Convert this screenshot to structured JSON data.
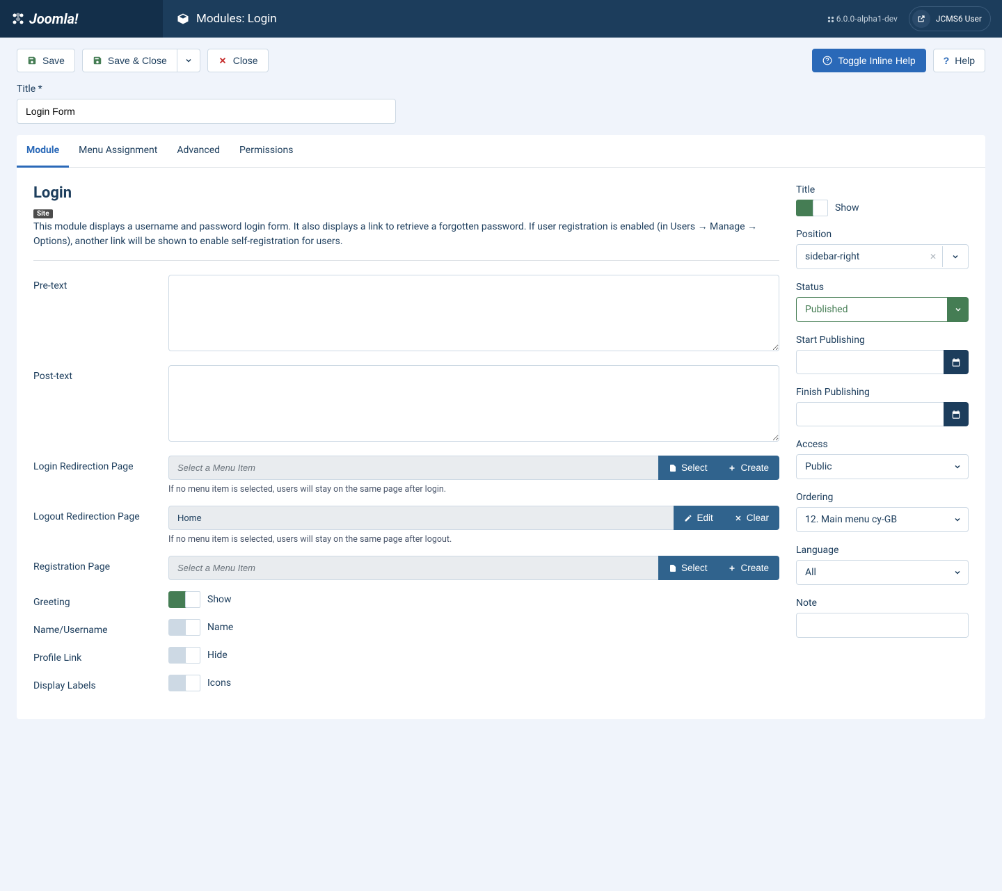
{
  "brand": "Joomla!",
  "header": {
    "title": "Modules: Login",
    "version": "6.0.0-alpha1-dev",
    "user": "JCMS6 User"
  },
  "toolbar": {
    "save": "Save",
    "save_close": "Save & Close",
    "close": "Close",
    "toggle_help": "Toggle Inline Help",
    "help": "Help"
  },
  "title_field": {
    "label": "Title *",
    "value": "Login Form"
  },
  "tabs": [
    "Module",
    "Menu Assignment",
    "Advanced",
    "Permissions"
  ],
  "module": {
    "heading": "Login",
    "badge": "Site",
    "desc": "This module displays a username and password login form. It also displays a link to retrieve a forgotten password. If user registration is enabled (in Users → Manage → Options), another link will be shown to enable self-registration for users.",
    "pretext_label": "Pre-text",
    "posttext_label": "Post-text",
    "login_redir_label": "Login Redirection Page",
    "login_redir_placeholder": "Select a Menu Item",
    "login_redir_help": "If no menu item is selected, users will stay on the same page after login.",
    "logout_redir_label": "Logout Redirection Page",
    "logout_redir_value": "Home",
    "logout_redir_help": "If no menu item is selected, users will stay on the same page after logout.",
    "reg_label": "Registration Page",
    "reg_placeholder": "Select a Menu Item",
    "select_btn": "Select",
    "create_btn": "Create",
    "edit_btn": "Edit",
    "clear_btn": "Clear",
    "greeting_label": "Greeting",
    "greeting_val": "Show",
    "nameuser_label": "Name/Username",
    "nameuser_val": "Name",
    "profile_label": "Profile Link",
    "profile_val": "Hide",
    "display_labels_label": "Display Labels",
    "display_labels_val": "Icons"
  },
  "side": {
    "title_label": "Title",
    "title_val": "Show",
    "position_label": "Position",
    "position_val": "sidebar-right",
    "status_label": "Status",
    "status_val": "Published",
    "start_pub_label": "Start Publishing",
    "finish_pub_label": "Finish Publishing",
    "access_label": "Access",
    "access_val": "Public",
    "ordering_label": "Ordering",
    "ordering_val": "12. Main menu cy-GB",
    "language_label": "Language",
    "language_val": "All",
    "note_label": "Note"
  }
}
